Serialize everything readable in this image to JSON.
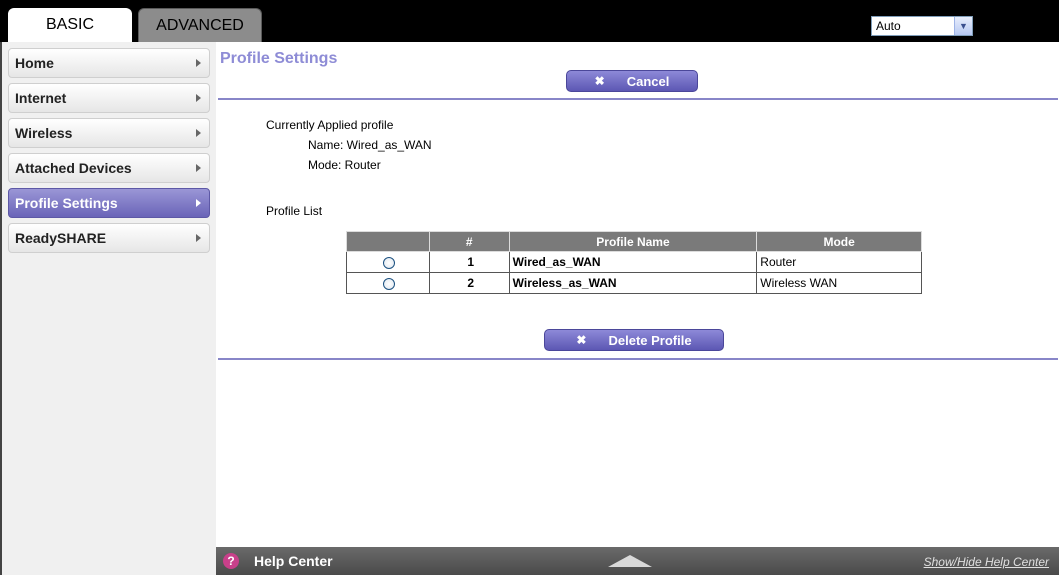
{
  "tabs": {
    "basic": "BASIC",
    "advanced": "ADVANCED"
  },
  "language": {
    "selected": "Auto"
  },
  "sidebar": {
    "items": [
      {
        "label": "Home"
      },
      {
        "label": "Internet"
      },
      {
        "label": "Wireless"
      },
      {
        "label": "Attached Devices"
      },
      {
        "label": "Profile Settings",
        "active": true
      },
      {
        "label": "ReadySHARE"
      }
    ]
  },
  "page": {
    "title": "Profile Settings",
    "cancel_label": "Cancel",
    "applied_heading": "Currently Applied profile",
    "applied_name": "Name: Wired_as_WAN",
    "applied_mode": "Mode: Router",
    "list_heading": "Profile List",
    "delete_label": "Delete Profile"
  },
  "table": {
    "headers": {
      "num": "#",
      "name": "Profile Name",
      "mode": "Mode"
    },
    "rows": [
      {
        "num": "1",
        "name": "Wired_as_WAN",
        "mode": "Router"
      },
      {
        "num": "2",
        "name": "Wireless_as_WAN",
        "mode": "Wireless WAN"
      }
    ]
  },
  "help": {
    "label": "Help Center",
    "toggle": "Show/Hide Help Center"
  },
  "colors": {
    "accent": "#8e8cd6",
    "active_nav": "#6a64b8",
    "table_header": "#7a7a7a"
  }
}
